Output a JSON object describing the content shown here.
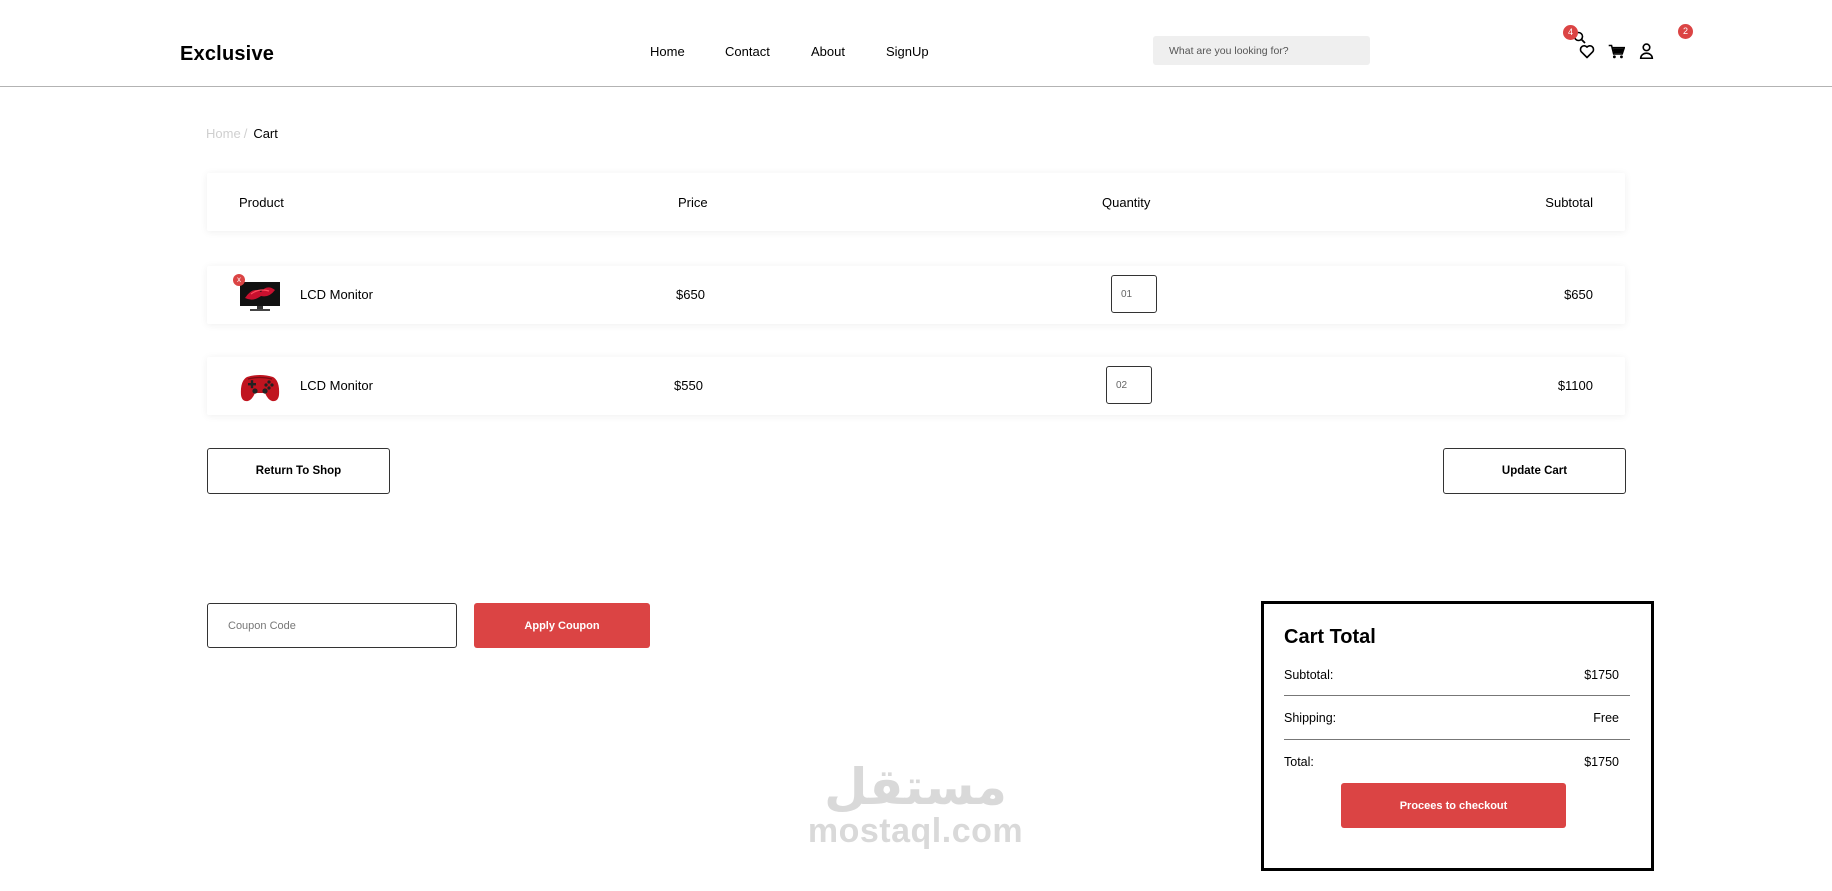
{
  "header": {
    "logo": "Exclusive",
    "nav": [
      "Home",
      "Contact",
      "About",
      "SignUp"
    ],
    "search_placeholder": "What are you looking for?",
    "wishlist_count": "4",
    "cart_count": "2"
  },
  "breadcrumb": {
    "prev": "Home",
    "current": "Cart"
  },
  "table": {
    "headers": [
      "Product",
      "Price",
      "Quantity",
      "Subtotal"
    ],
    "rows": [
      {
        "name": "LCD Monitor",
        "price": "$650",
        "qty": "01",
        "subtotal": "$650",
        "remove": "x"
      },
      {
        "name": "LCD Monitor",
        "price": "$550",
        "qty": "02",
        "subtotal": "$1100"
      }
    ]
  },
  "actions": {
    "return": "Return To Shop",
    "update": "Update Cart"
  },
  "coupon": {
    "placeholder": "Coupon Code",
    "apply": "Apply Coupon"
  },
  "cart_total": {
    "title": "Cart Total",
    "subtotal_label": "Subtotal:",
    "subtotal": "$1750",
    "shipping_label": "Shipping:",
    "shipping": "Free",
    "total_label": "Total:",
    "total": "$1750",
    "checkout": "Procees to checkout"
  },
  "watermark": {
    "arabic": "مستقل",
    "latin": "mostaql.com"
  },
  "colors": {
    "accent": "#db4444"
  }
}
